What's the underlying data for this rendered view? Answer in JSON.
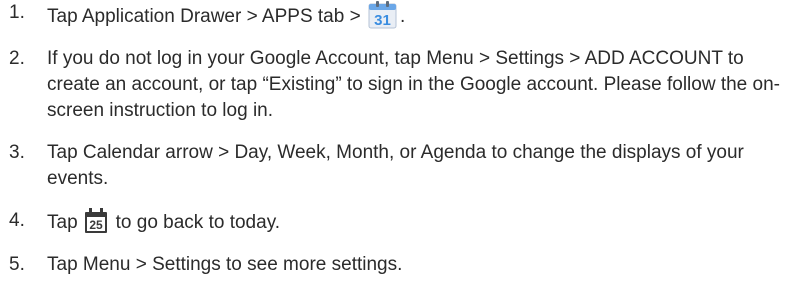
{
  "steps": [
    {
      "number": "1.",
      "before_icon": "Tap Application Drawer > APPS tab > ",
      "icon": "calendar-app-icon",
      "icon_text": "31",
      "after_icon": "."
    },
    {
      "number": "2.",
      "text": "If you do not log in your Google Account, tap Menu > Settings > ADD ACCOUNT to create an account, or tap “Existing” to sign in the Google account. Please follow the on-screen instruction to log in."
    },
    {
      "number": "3.",
      "text": "Tap Calendar arrow > Day, Week, Month, or Agenda to change the displays of your events."
    },
    {
      "number": "4.",
      "before_icon": "Tap",
      "icon": "today-icon",
      "icon_text": "25",
      "after_icon": "to go back to today."
    },
    {
      "number": "5.",
      "text": "Tap Menu > Settings to see more settings."
    }
  ],
  "colors": {
    "text": "#2b2b2b",
    "calendar_blue": "#3a8de0",
    "today_icon": "#3a3a3a"
  }
}
